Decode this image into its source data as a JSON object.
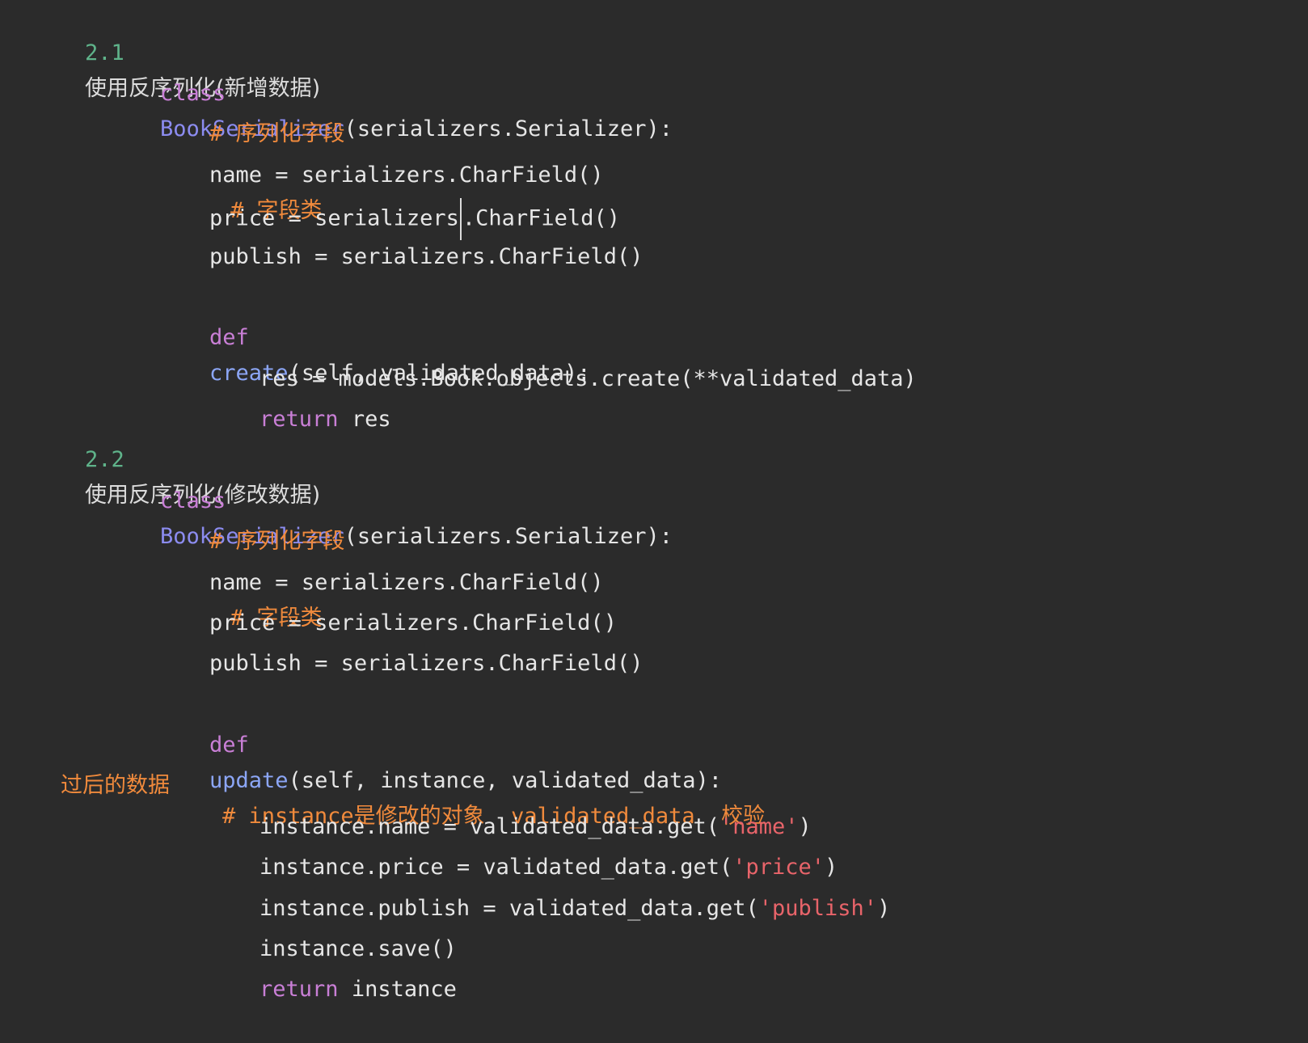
{
  "colors": {
    "background": "#2b2b2b",
    "keyword": "#c97fd6",
    "class_name": "#8c8cf0",
    "function_name": "#8ca6f6",
    "comment": "#f08a3c",
    "string": "#e8646a",
    "number": "#5fb38a",
    "plain": "#e6e6e6"
  },
  "section1": {
    "number": "2.1",
    "title": "使用反序列化(新增数据)",
    "class_kw": "class",
    "class_name": "BookSerializer",
    "class_rest": "(serializers.Serializer):",
    "comment1": "# 序列化字段",
    "name_line": "name = serializers.CharField()",
    "name_comment": "# 字段类",
    "price_before_cursor": "price = serializers",
    "price_after_cursor": ".CharField()",
    "publish_line": "publish = serializers.CharField()",
    "def_kw": "def",
    "fn_name": "create",
    "fn_rest": "(self, validated_data):",
    "res_line": "res = models.Book.objects.create(**validated_data)",
    "return_kw": "return",
    "return_rest": " res"
  },
  "section2": {
    "number": "2.2",
    "title": "使用反序列化(修改数据)",
    "class_kw": "class",
    "class_name": "BookSerializer",
    "class_rest": "(serializers.Serializer):",
    "comment1": "# 序列化字段",
    "name_line": "name = serializers.CharField()",
    "name_comment": "# 字段类",
    "price_line": "price = serializers.CharField()",
    "publish_line": "publish = serializers.CharField()",
    "def_kw": "def",
    "fn_name": "update",
    "fn_rest": "(self, instance, validated_data):",
    "fn_comment": "# instance是修改的对象  validated_data  校验",
    "fn_comment_wrap": "过后的数据",
    "l1_before": "instance.name = validated_data.get(",
    "l1_str": "'name'",
    "l1_after": ")",
    "l2_before": "instance.price = validated_data.get(",
    "l2_str": "'price'",
    "l2_after": ")",
    "l3_before": "instance.publish = validated_data.get(",
    "l3_str": "'publish'",
    "l3_after": ")",
    "save_line": "instance.save()",
    "return_kw": "return",
    "return_rest": " instance"
  }
}
